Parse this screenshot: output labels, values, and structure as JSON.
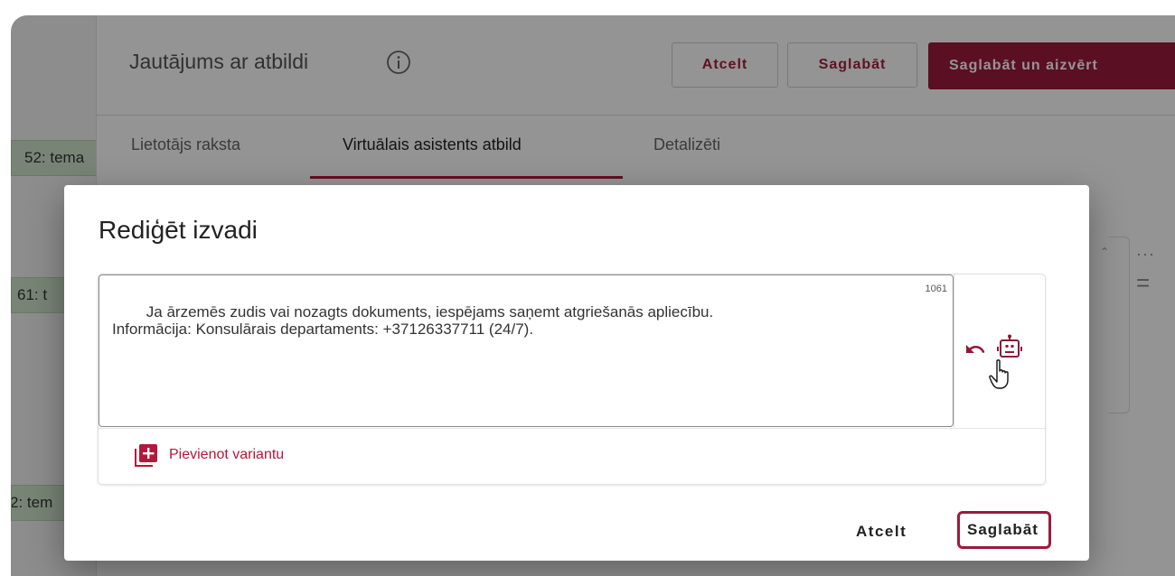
{
  "background": {
    "title": "Jautājums ar atbildi",
    "buttons": {
      "cancel": "Atcelt",
      "save": "Saglabāt",
      "save_close": "Saglabāt un aizvērt"
    },
    "tabs": [
      {
        "label": "Lietotājs raksta"
      },
      {
        "label": "Virtuālais asistents atbild",
        "active": true
      },
      {
        "label": "Detalizēti"
      }
    ],
    "side_items": [
      "52: tema",
      "61: t",
      "2: tem"
    ]
  },
  "dialog": {
    "title": "Rediģēt izvadi",
    "text": "Ja ārzemēs zudis vai nozagts dokuments, iespējams saņemt atgriešanās apliecību.\nInformācija: Konsulārais departaments: +37126337711 (24/7).",
    "char_count": "1061",
    "add_variant_label": "Pievienot variantu",
    "cancel_label": "Atcelt",
    "save_label": "Saglabāt"
  },
  "colors": {
    "accent": "#9b1b3d",
    "chip_bg": "#cfe6cb"
  },
  "icons": [
    "info-icon",
    "undo-icon",
    "robot-icon",
    "add-variant-icon",
    "cursor-icon"
  ]
}
